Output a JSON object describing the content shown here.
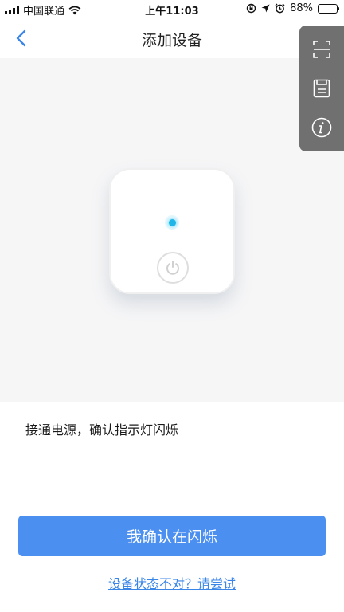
{
  "status_bar": {
    "carrier": "中国联通",
    "time": "上午11:03",
    "battery_percent": "88%",
    "battery_level": 0.88,
    "icons": [
      "signal-icon",
      "wifi-icon",
      "rotation-lock-icon",
      "location-icon",
      "alarm-icon",
      "battery-icon"
    ]
  },
  "nav": {
    "title": "添加设备",
    "back_icon": "chevron-left-icon"
  },
  "toolbar": {
    "icons": [
      "scan-icon",
      "save-icon",
      "info-icon"
    ]
  },
  "device": {
    "indicator_color": "#1fb6e8"
  },
  "instruction": "接通电源，确认指示灯闪烁",
  "confirm_button": "我确认在闪烁",
  "help_link": "设备状态不对？请尝试",
  "colors": {
    "accent": "#4b8ff0",
    "link": "#3a86e8",
    "toolbar_bg": "#707070"
  }
}
